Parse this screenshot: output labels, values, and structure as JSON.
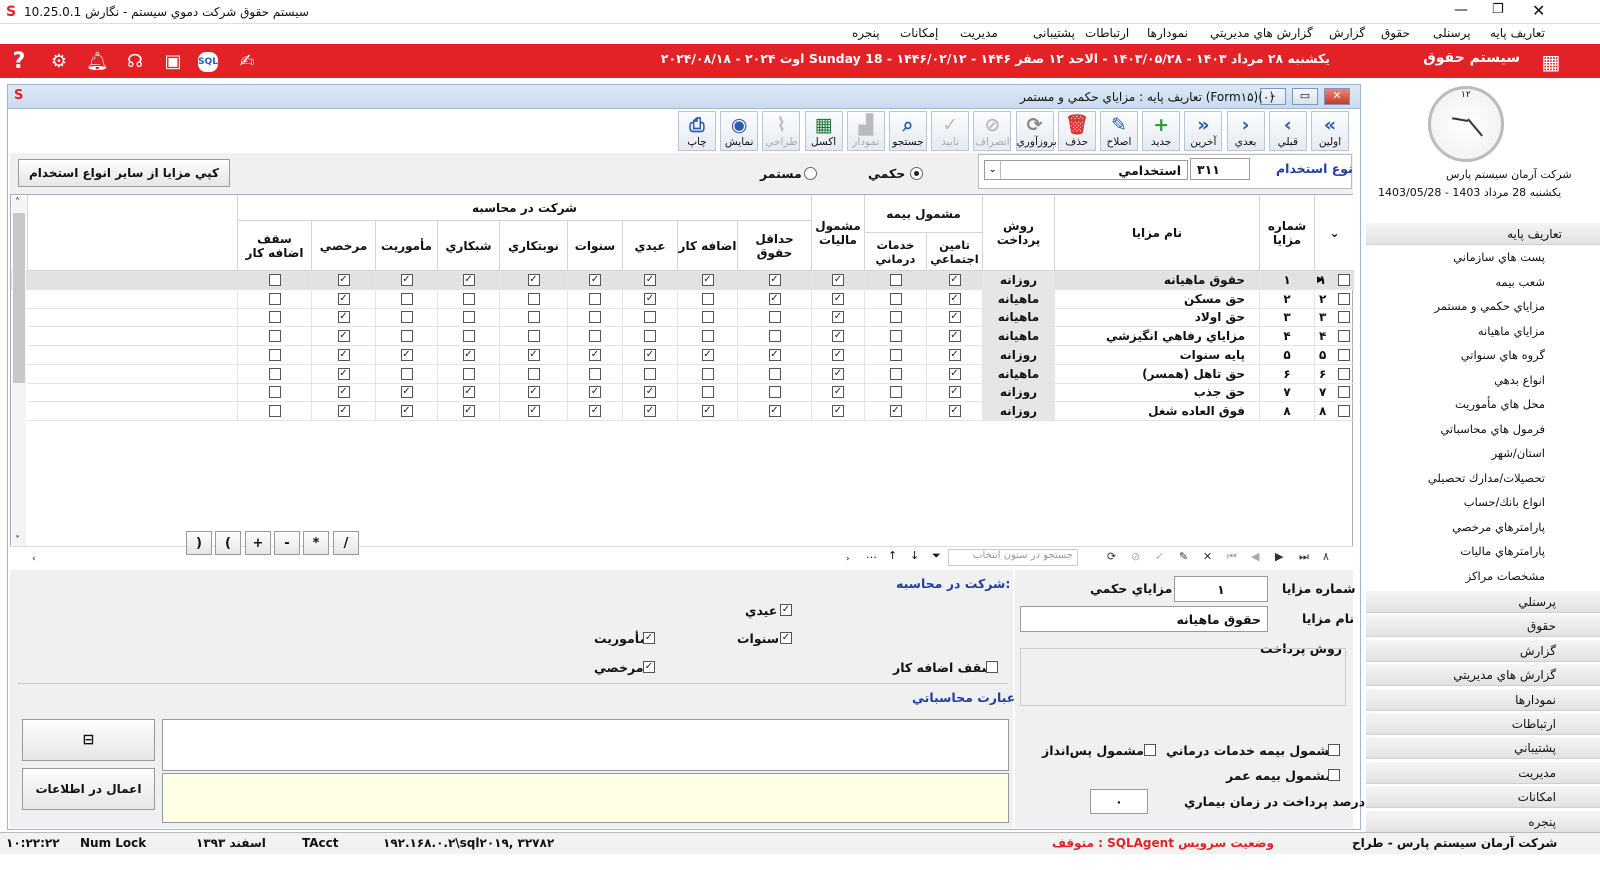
{
  "window": {
    "title": "سیستم حقوق شرکت دموي سیستم - نگارش 10.25.0.1"
  },
  "menu": [
    "تعاریف پایه",
    "پرسنلی",
    "حقوق",
    "گزارش",
    "گزارش هاي مديريتي",
    "نمودارها",
    "ارتباطات",
    "پشتیبانی",
    "مدیریت",
    "إمكانات",
    "پنجره"
  ],
  "header": {
    "app_title": "سیستم حقوق",
    "date_text": "یکشنبه ۲۸ مرداد ۱۴۰۳ - ۱۴۰۳/۰۵/۲۸ - الاحد ۱۲ صفر ۱۴۴۶ - ۱۴۴۶/۰۲/۱۲ - Sunday 18 اوت ۲۰۲۴ - ۲۰۲۴/۰۸/۱۸"
  },
  "form": {
    "title": "تعاريف پايه : مزاياي حكمي و مستمر (Form۱۵)(۰)"
  },
  "toolbar": [
    {
      "label": "اولين",
      "icon": "double-chevron-left"
    },
    {
      "label": "قبلي",
      "icon": "chevron-left"
    },
    {
      "label": "بعدي",
      "icon": "chevron-right"
    },
    {
      "label": "آخرين",
      "icon": "double-chevron-right"
    },
    {
      "label": "جديد",
      "icon": "plus"
    },
    {
      "label": "اصلاح",
      "icon": "pencil"
    },
    {
      "label": "حذف",
      "icon": "trash"
    },
    {
      "label": "بروزآوري",
      "icon": "refresh"
    },
    {
      "label": "انصراف",
      "icon": "cancel"
    },
    {
      "label": "تاييد",
      "icon": "check"
    },
    {
      "label": "جستجو",
      "icon": "search"
    },
    {
      "label": "نمودار",
      "icon": "chart"
    },
    {
      "label": "اكسل",
      "icon": "excel"
    },
    {
      "label": "طراحي",
      "icon": "brush"
    },
    {
      "label": "نمايش",
      "icon": "eye"
    },
    {
      "label": "چاپ",
      "icon": "printer"
    }
  ],
  "filter": {
    "employment_label": "نوع استخدام",
    "employment_code": "۳۱۱",
    "employment_name": "استخدامي",
    "radio_hokmi": "حكمي",
    "radio_mostamar": "مستمر",
    "copy_button": "كپي مزايا از ساير انواع استخدام"
  },
  "grid": {
    "headers": {
      "row_no": "شماره مزايا",
      "name": "نام مزايا",
      "pay_method": "روش پرداخت",
      "insurance_group": "مشمول بيمه",
      "ins_social": "تامين اجتماعي",
      "ins_medical": "خدمات درماني",
      "tax": "مشمول ماليات",
      "calc_group": "شركت در محاسبه",
      "min_wage": "حداقل حقوق",
      "overtime": "اضافه كار",
      "eidi": "عيدي",
      "sanavat": "سنوات",
      "nobatkari": "نوبتكاري",
      "shabkari": "شبكاري",
      "mamooriat": "مأموريت",
      "morakhasi": "مرخصي",
      "overtime_cap": "سقف اضافه كار"
    },
    "rows": [
      {
        "idx": "۱",
        "no": "۱",
        "name": "حقوق ماهيانه",
        "pay": "روزانه",
        "f": [
          1,
          0,
          1,
          1,
          1,
          1,
          1,
          1,
          1,
          1,
          1,
          0
        ]
      },
      {
        "idx": "۲",
        "no": "۲",
        "name": "حق مسكن",
        "pay": "ماهيانه",
        "f": [
          1,
          0,
          1,
          1,
          0,
          1,
          0,
          0,
          0,
          0,
          1,
          0
        ]
      },
      {
        "idx": "۳",
        "no": "۳",
        "name": "حق اولاد",
        "pay": "ماهيانه",
        "f": [
          1,
          0,
          1,
          0,
          0,
          0,
          0,
          0,
          0,
          0,
          1,
          0
        ]
      },
      {
        "idx": "۴",
        "no": "۴",
        "name": "مزاياي رفاهي انگيزشي",
        "pay": "ماهيانه",
        "f": [
          1,
          0,
          1,
          0,
          0,
          0,
          0,
          0,
          0,
          0,
          1,
          0
        ]
      },
      {
        "idx": "۵",
        "no": "۵",
        "name": "پايه سنوات",
        "pay": "روزانه",
        "f": [
          1,
          0,
          1,
          1,
          1,
          1,
          1,
          1,
          1,
          1,
          1,
          0
        ]
      },
      {
        "idx": "۶",
        "no": "۶",
        "name": "حق تاهل (همسر)",
        "pay": "ماهيانه",
        "f": [
          1,
          0,
          1,
          0,
          0,
          0,
          0,
          0,
          0,
          0,
          1,
          0
        ]
      },
      {
        "idx": "۷",
        "no": "۷",
        "name": "حق جذب",
        "pay": "روزانه",
        "f": [
          1,
          0,
          1,
          0,
          0,
          1,
          1,
          1,
          1,
          1,
          1,
          0
        ]
      },
      {
        "idx": "۸",
        "no": "۸",
        "name": "فوق العاده شغل",
        "pay": "روزانه",
        "f": [
          1,
          1,
          1,
          1,
          1,
          1,
          1,
          1,
          1,
          1,
          1,
          0
        ]
      }
    ],
    "search_placeholder": "جستجو در ستون انتخاب",
    "nav_count": "۸",
    "ops": [
      "/",
      "*",
      "-",
      "+",
      "(",
      ")"
    ]
  },
  "detail": {
    "benefit_no_label": "شماره مزايا",
    "benefit_no": "۱",
    "hokmi_label": "مزاياي حكمي",
    "benefit_name_label": "نام مزايا",
    "benefit_name": "حقوق ماهيانه",
    "pay_method_label": "روش پرداخت",
    "ins_medical_label": "مشمول بيمه خدمات درماني",
    "savings_label": "مشمول پس‌انداز",
    "life_ins_label": "مشمول بيمه عمر",
    "sick_pay_label": "درصد پرداخت در زمان بيماري",
    "sick_pay_value": "۰",
    "calc_title": "شركت در محاسبه:",
    "eidi": "عيدي",
    "sanavat": "سنوات",
    "mamooriat": "مأموريت",
    "overtime_cap": "سقف اضافه كار",
    "morakhasi": "مرخصي",
    "expr_title": "عبارت محاسباتي",
    "apply_button": "اعمال در اطلاعات"
  },
  "sidebar": {
    "company": "شركت آرمان سيستم پارس",
    "date": "يكشنبه 28 مرداد 1403 - 1403/05/28",
    "clock_label": "۱۲",
    "section": "تعاريف پايه",
    "items": [
      "پست هاي سازماني",
      "شعب بيمه",
      "مزاياي حكمي و مستمر",
      "مزاياي ماهيانه",
      "گروه هاي سنواتي",
      "انواع بدهي",
      "محل هاي مأموريت",
      "فرمول هاي محاسباتي",
      "استان/شهر",
      "تحصيلات/مدارك تحصيلي",
      "انواع بانك/حساب",
      "پارامترهاي مرخصي",
      "پارامترهاي ماليات",
      "مشخصات مراكز"
    ],
    "groups": [
      "پرسنلي",
      "حقوق",
      "گزارش",
      "گزارش هاي مديريتي",
      "نمودارها",
      "ارتباطات",
      "پشتيباني",
      "مديريت",
      "امكانات",
      "پنجره"
    ]
  },
  "status": {
    "company": "شركت آرمان سيستم پارس - طراح",
    "agent": "متوقف : SQLAgent وضعيت سرويس",
    "server": "۱۹۲.۱۶۸.۰.۲\\sql۲۰۱۹, ۳۲۷۸۲",
    "user": "TAcct",
    "month": "اسفند ۱۳۹۳",
    "numlock": "Num Lock",
    "time": "۱۰:۲۲:۲۲"
  },
  "colors": {
    "accent": "#e32228",
    "blue": "#1f3ea0"
  }
}
